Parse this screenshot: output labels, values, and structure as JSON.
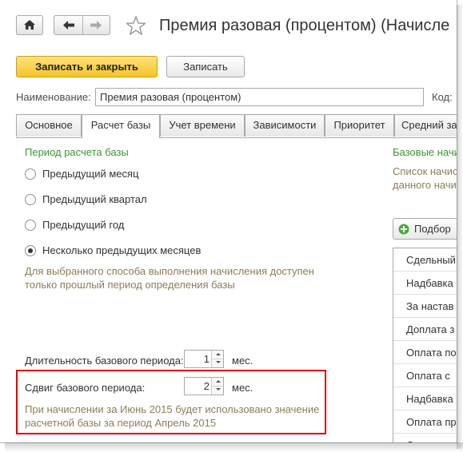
{
  "title": "Премия разовая (процентом) (Начисле",
  "toolbar": {
    "save_close_label": "Записать и закрыть",
    "save_label": "Записать"
  },
  "name_label": "Наименование:",
  "name_value": "Премия разовая (процентом)",
  "code_label": "Код:",
  "tabs": [
    {
      "label": "Основное"
    },
    {
      "label": "Расчет базы",
      "active": true
    },
    {
      "label": "Учет времени"
    },
    {
      "label": "Зависимости"
    },
    {
      "label": "Приоритет"
    },
    {
      "label": "Средний за"
    }
  ],
  "period": {
    "heading": "Период расчета базы",
    "options": [
      {
        "label": "Предыдущий месяц",
        "selected": false
      },
      {
        "label": "Предыдущий квартал",
        "selected": false
      },
      {
        "label": "Предыдущий год",
        "selected": false
      },
      {
        "label": "Несколько предыдущих месяцев",
        "selected": true
      }
    ],
    "hint": "Для выбранного способа выполнения начисления доступен только прошлый период определения базы"
  },
  "duration": {
    "label": "Длительность базового периода:",
    "value": "1",
    "unit": "мес."
  },
  "shift": {
    "label": "Сдвиг базового периода:",
    "value": "2",
    "unit": "мес."
  },
  "shift_note": "При начислении за Июнь 2015 будет использовано значение расчетной базы за период Апрель 2015",
  "right": {
    "heading": "Базовые начи",
    "desc_line1": "Список начис",
    "desc_line2": "данного начи",
    "pick_label": "Подбор",
    "list": [
      "Сдельный",
      "Надбавка",
      "За настав",
      "Доплата з",
      "Оплата по",
      "Оплата с",
      "Надбавка",
      "Оплата пр",
      "Сверхурочн"
    ]
  },
  "colors": {
    "accent_yellow": "#f5c526",
    "green_heading": "#3d9434",
    "highlight_red": "#e00000"
  }
}
